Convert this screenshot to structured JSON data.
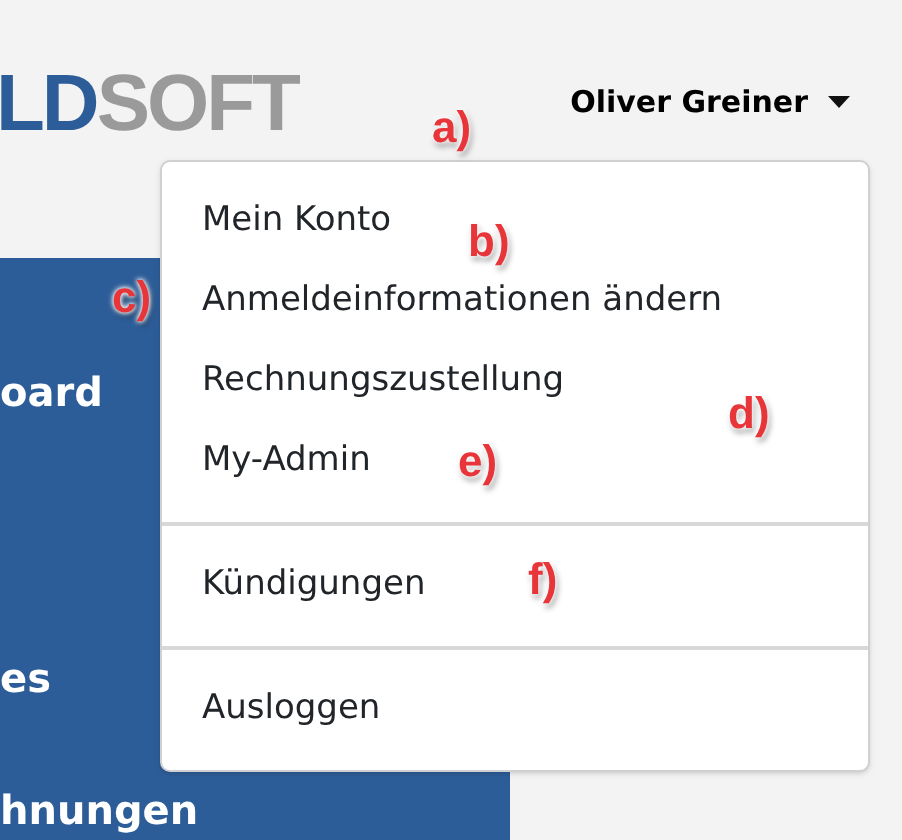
{
  "logo": {
    "part_1": "LD",
    "part_2": "SOFT"
  },
  "user_menu": {
    "label": "Oliver Greiner",
    "expanded": true
  },
  "sidebar": {
    "items": [
      "oard",
      "es",
      "hnungen"
    ]
  },
  "dropdown": {
    "sections": [
      [
        "Mein Konto",
        "Anmeldeinformationen ändern",
        "Rechnungszustellung",
        "My-Admin"
      ],
      [
        "Kündigungen"
      ],
      [
        "Ausloggen"
      ]
    ]
  },
  "annotations": [
    "a)",
    "b)",
    "c)",
    "d)",
    "e)",
    "f)"
  ]
}
